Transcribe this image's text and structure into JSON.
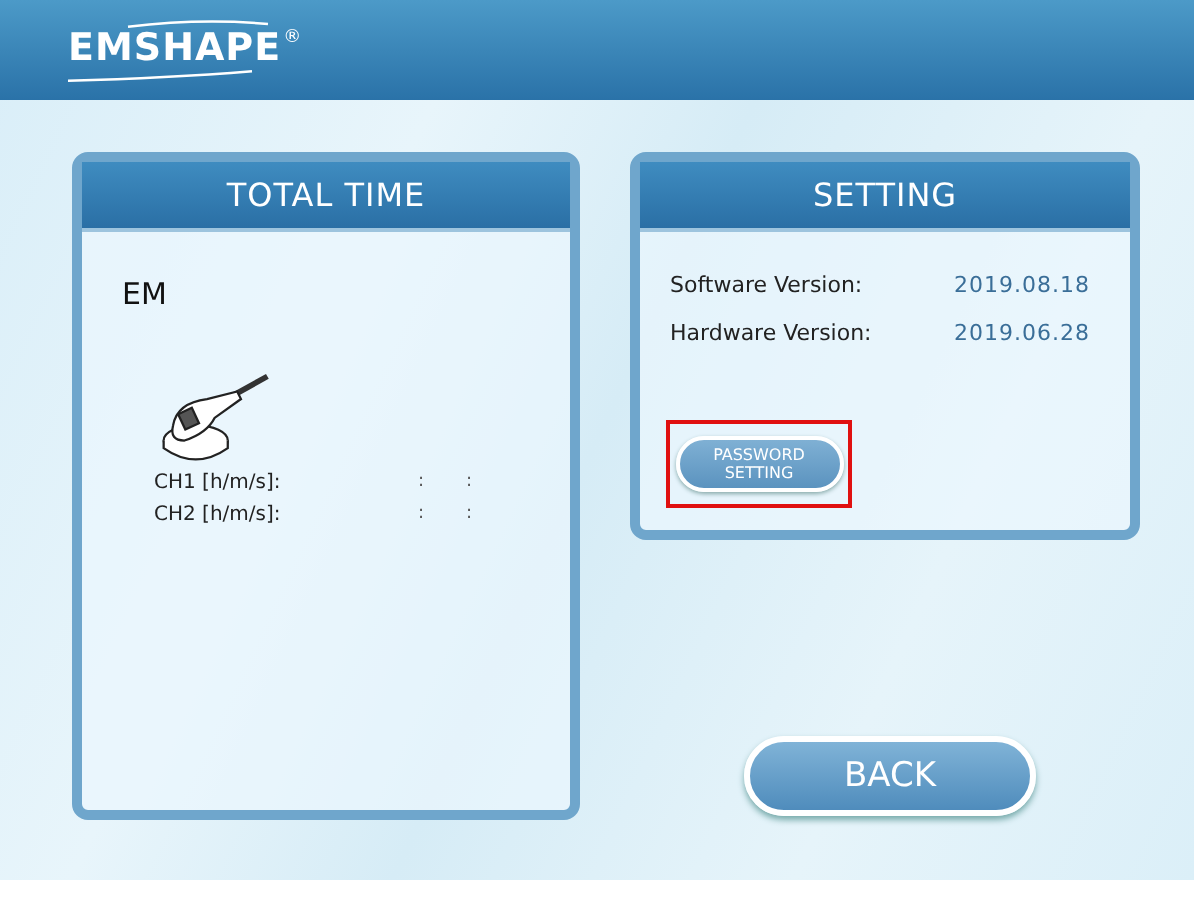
{
  "header": {
    "logo": "EMSHAPE",
    "trademark": "®"
  },
  "total_time": {
    "title": "TOTAL TIME",
    "device": "EM",
    "channels": [
      {
        "label": "CH1 [h/m/s]:",
        "separators": [
          ":",
          ":"
        ]
      },
      {
        "label": "CH2 [h/m/s]:",
        "separators": [
          ":",
          ":"
        ]
      }
    ]
  },
  "setting": {
    "title": "SETTING",
    "versions": [
      {
        "label": "Software Version:",
        "value": "2019.08.18"
      },
      {
        "label": "Hardware Version:",
        "value": "2019.06.28"
      }
    ],
    "password_button": {
      "lines": [
        "PASSWORD",
        "SETTING"
      ],
      "highlighted": true
    }
  },
  "back_button": "BACK"
}
